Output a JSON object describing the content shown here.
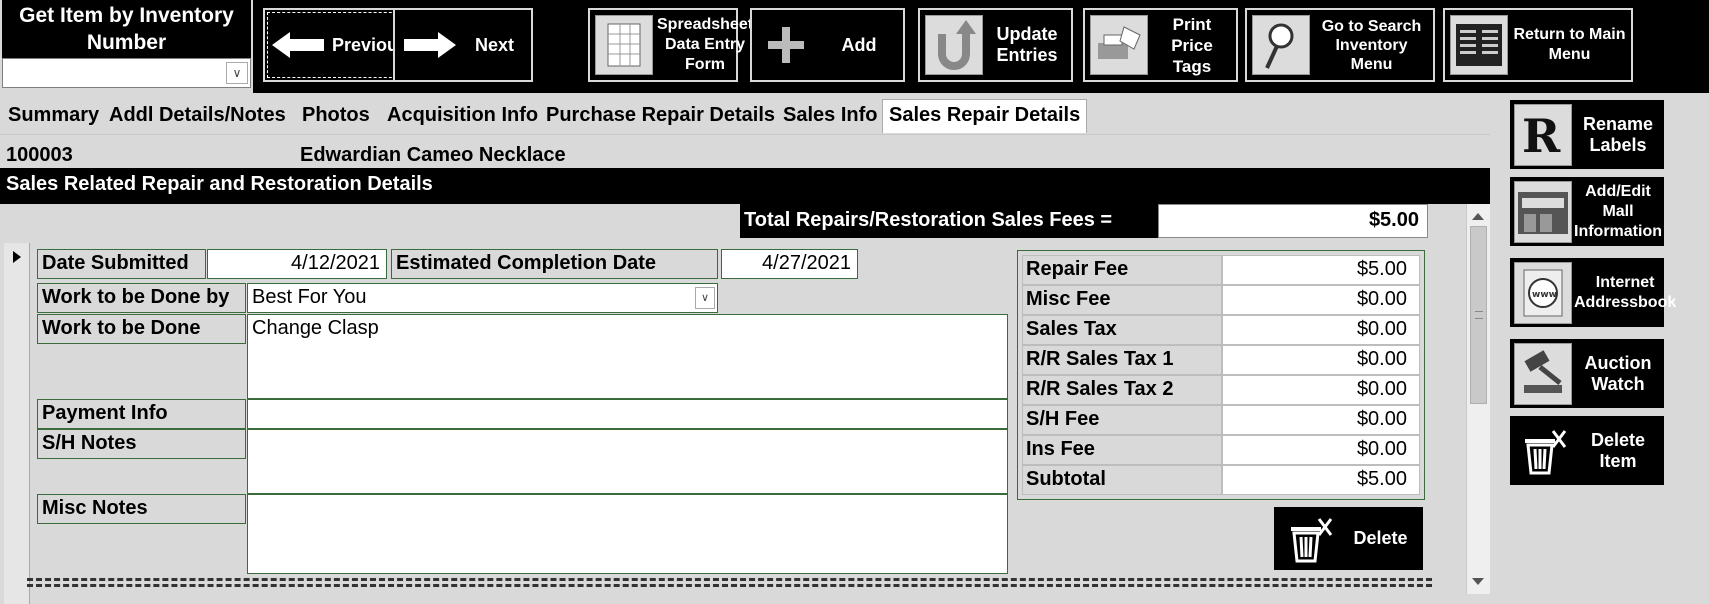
{
  "header": {
    "get_item_label": "Get Item by Inventory Number",
    "inventory_select_value": ""
  },
  "toolbar": {
    "previous": "Previous",
    "next": "Next",
    "spreadsheet": "Spreadsheet Data Entry Form",
    "add": "Add",
    "update": "Update Entries",
    "print": "Print Price Tags",
    "search": "Go to Search Inventory Menu",
    "return": "Return to Main Menu"
  },
  "tabs": [
    {
      "label": "Summary"
    },
    {
      "label": "Addl Details/Notes"
    },
    {
      "label": "Photos"
    },
    {
      "label": "Acquisition Info"
    },
    {
      "label": "Purchase Repair Details"
    },
    {
      "label": "Sales Info"
    },
    {
      "label": "Sales Repair Details"
    }
  ],
  "record": {
    "id": "100003",
    "name": "Edwardian Cameo Necklace"
  },
  "section": {
    "title": "Sales Related Repair and Restoration Details",
    "total_label": "Total Repairs/Restoration Sales Fees =",
    "total_value": "$5.00"
  },
  "form": {
    "date_submitted_label": "Date Submitted",
    "date_submitted_value": "4/12/2021",
    "est_completion_label": "Estimated Completion Date",
    "est_completion_value": "4/27/2021",
    "work_by_label": "Work to be Done by",
    "work_by_value": "Best For You",
    "work_label": "Work to be Done",
    "work_value": "Change Clasp",
    "payment_label": "Payment Info",
    "payment_value": "",
    "sh_notes_label": "S/H Notes",
    "sh_notes_value": "",
    "misc_notes_label": "Misc Notes",
    "misc_notes_value": ""
  },
  "fees": [
    {
      "label": "Repair Fee",
      "value": "$5.00"
    },
    {
      "label": "Misc Fee",
      "value": "$0.00"
    },
    {
      "label": "Sales Tax",
      "value": "$0.00"
    },
    {
      "label": "R/R Sales Tax 1",
      "value": "$0.00"
    },
    {
      "label": "R/R Sales Tax 2",
      "value": "$0.00"
    },
    {
      "label": "S/H Fee",
      "value": "$0.00"
    },
    {
      "label": "Ins Fee",
      "value": "$0.00"
    },
    {
      "label": "Subtotal",
      "value": "$5.00"
    }
  ],
  "delete_label": "Delete",
  "sidebar": {
    "rename": "Rename Labels",
    "mall": "Add/Edit Mall Information",
    "internet": "Internet Addressbook",
    "auction": "Auction Watch",
    "delete_item": "Delete Item"
  },
  "icons": [
    "arrow-left-icon",
    "arrow-right-icon",
    "spreadsheet-icon",
    "plus-icon",
    "u-turn-icon",
    "price-tag-printer-icon",
    "search-magnifier-icon",
    "menu-thumbnail-icon",
    "r-letter-icon",
    "mall-storefront-icon",
    "www-globe-icon",
    "gavel-icon",
    "trash-icon"
  ]
}
